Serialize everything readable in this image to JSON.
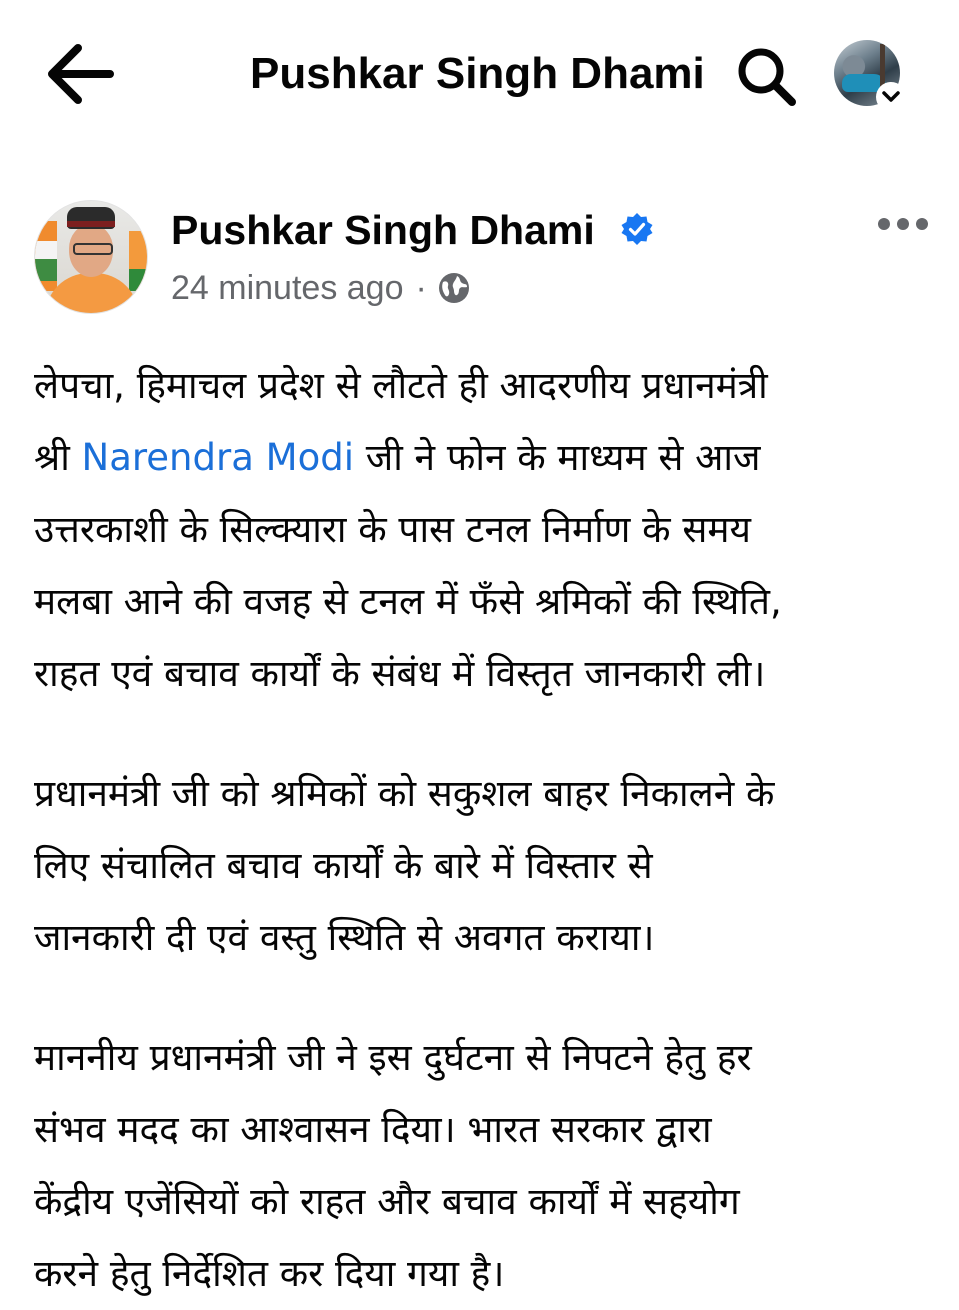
{
  "topbar": {
    "title": "Pushkar Singh Dhami",
    "icons": [
      "arrow-left-icon",
      "search-icon",
      "chevron-down-icon"
    ]
  },
  "post": {
    "author": "Pushkar Singh Dhami",
    "verified": true,
    "timestamp": "24 minutes ago",
    "separator": "·",
    "audience_icon": "globe-icon",
    "menu_icon": "more-horizontal-icon",
    "paragraphs": [
      {
        "before": "लेपचा, हिमाचल प्रदेश से लौटते ही आदरणीय प्रधानमंत्री\nश्री ",
        "mention": "Narendra Modi",
        "after": " जी ने फोन के माध्यम से आज\nउत्तरकाशी के सिल्क्यारा के पास टनल निर्माण के समय\nमलबा आने की वजह से टनल में फँसे श्रमिकों की स्थिति,\nराहत एवं बचाव कार्यों के संबंध में विस्तृत जानकारी ली।"
      },
      {
        "text": "प्रधानमंत्री जी को श्रमिकों को सकुशल बाहर निकालने के\nलिए संचालित बचाव कार्यों के बारे में विस्तार से\nजानकारी दी एवं वस्तु स्थिति से अवगत कराया।"
      },
      {
        "text": "माननीय प्रधानमंत्री जी ने इस दुर्घटना से निपटने हेतु हर\nसंभव मदद का आश्वासन दिया। भारत सरकार द्वारा\nकेंद्रीय एजेंसियों को राहत और बचाव कार्यों में सहयोग\nकरने हेतु निर्देशित कर दिया गया है।"
      }
    ]
  },
  "colors": {
    "text": "#050505",
    "secondary_text": "#65676b",
    "link": "#1b6fd8",
    "verified_badge": "#1877f2",
    "background": "#ffffff"
  }
}
